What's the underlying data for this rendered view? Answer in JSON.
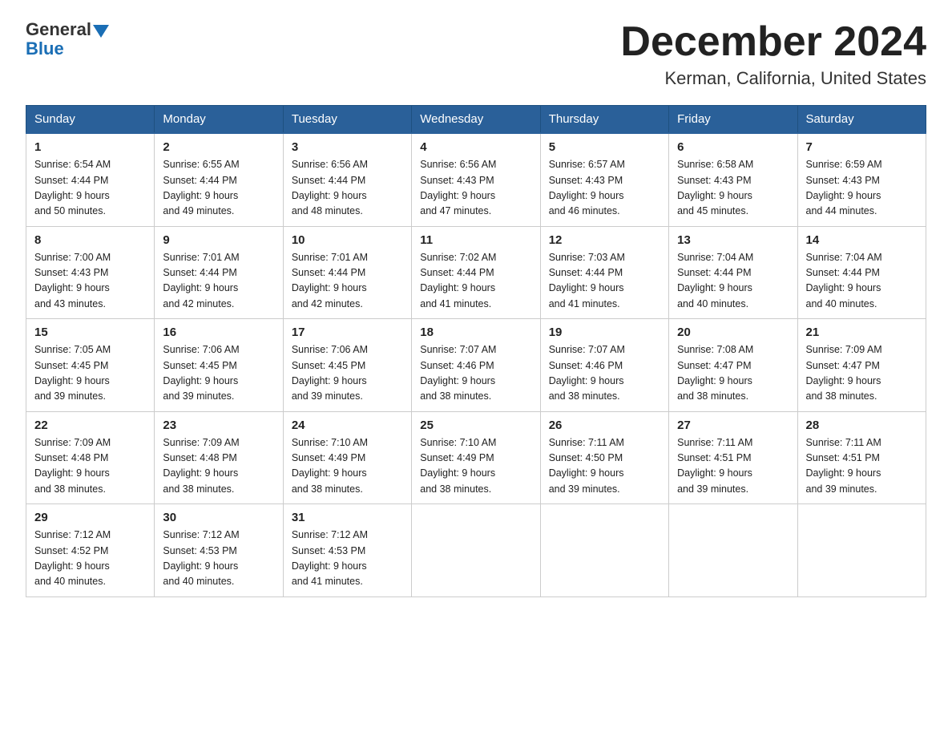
{
  "header": {
    "logo_general": "General",
    "logo_blue": "Blue",
    "month_title": "December 2024",
    "location": "Kerman, California, United States"
  },
  "days_of_week": [
    "Sunday",
    "Monday",
    "Tuesday",
    "Wednesday",
    "Thursday",
    "Friday",
    "Saturday"
  ],
  "weeks": [
    [
      {
        "day": "1",
        "sunrise": "6:54 AM",
        "sunset": "4:44 PM",
        "daylight": "9 hours and 50 minutes."
      },
      {
        "day": "2",
        "sunrise": "6:55 AM",
        "sunset": "4:44 PM",
        "daylight": "9 hours and 49 minutes."
      },
      {
        "day": "3",
        "sunrise": "6:56 AM",
        "sunset": "4:44 PM",
        "daylight": "9 hours and 48 minutes."
      },
      {
        "day": "4",
        "sunrise": "6:56 AM",
        "sunset": "4:43 PM",
        "daylight": "9 hours and 47 minutes."
      },
      {
        "day": "5",
        "sunrise": "6:57 AM",
        "sunset": "4:43 PM",
        "daylight": "9 hours and 46 minutes."
      },
      {
        "day": "6",
        "sunrise": "6:58 AM",
        "sunset": "4:43 PM",
        "daylight": "9 hours and 45 minutes."
      },
      {
        "day": "7",
        "sunrise": "6:59 AM",
        "sunset": "4:43 PM",
        "daylight": "9 hours and 44 minutes."
      }
    ],
    [
      {
        "day": "8",
        "sunrise": "7:00 AM",
        "sunset": "4:43 PM",
        "daylight": "9 hours and 43 minutes."
      },
      {
        "day": "9",
        "sunrise": "7:01 AM",
        "sunset": "4:44 PM",
        "daylight": "9 hours and 42 minutes."
      },
      {
        "day": "10",
        "sunrise": "7:01 AM",
        "sunset": "4:44 PM",
        "daylight": "9 hours and 42 minutes."
      },
      {
        "day": "11",
        "sunrise": "7:02 AM",
        "sunset": "4:44 PM",
        "daylight": "9 hours and 41 minutes."
      },
      {
        "day": "12",
        "sunrise": "7:03 AM",
        "sunset": "4:44 PM",
        "daylight": "9 hours and 41 minutes."
      },
      {
        "day": "13",
        "sunrise": "7:04 AM",
        "sunset": "4:44 PM",
        "daylight": "9 hours and 40 minutes."
      },
      {
        "day": "14",
        "sunrise": "7:04 AM",
        "sunset": "4:44 PM",
        "daylight": "9 hours and 40 minutes."
      }
    ],
    [
      {
        "day": "15",
        "sunrise": "7:05 AM",
        "sunset": "4:45 PM",
        "daylight": "9 hours and 39 minutes."
      },
      {
        "day": "16",
        "sunrise": "7:06 AM",
        "sunset": "4:45 PM",
        "daylight": "9 hours and 39 minutes."
      },
      {
        "day": "17",
        "sunrise": "7:06 AM",
        "sunset": "4:45 PM",
        "daylight": "9 hours and 39 minutes."
      },
      {
        "day": "18",
        "sunrise": "7:07 AM",
        "sunset": "4:46 PM",
        "daylight": "9 hours and 38 minutes."
      },
      {
        "day": "19",
        "sunrise": "7:07 AM",
        "sunset": "4:46 PM",
        "daylight": "9 hours and 38 minutes."
      },
      {
        "day": "20",
        "sunrise": "7:08 AM",
        "sunset": "4:47 PM",
        "daylight": "9 hours and 38 minutes."
      },
      {
        "day": "21",
        "sunrise": "7:09 AM",
        "sunset": "4:47 PM",
        "daylight": "9 hours and 38 minutes."
      }
    ],
    [
      {
        "day": "22",
        "sunrise": "7:09 AM",
        "sunset": "4:48 PM",
        "daylight": "9 hours and 38 minutes."
      },
      {
        "day": "23",
        "sunrise": "7:09 AM",
        "sunset": "4:48 PM",
        "daylight": "9 hours and 38 minutes."
      },
      {
        "day": "24",
        "sunrise": "7:10 AM",
        "sunset": "4:49 PM",
        "daylight": "9 hours and 38 minutes."
      },
      {
        "day": "25",
        "sunrise": "7:10 AM",
        "sunset": "4:49 PM",
        "daylight": "9 hours and 38 minutes."
      },
      {
        "day": "26",
        "sunrise": "7:11 AM",
        "sunset": "4:50 PM",
        "daylight": "9 hours and 39 minutes."
      },
      {
        "day": "27",
        "sunrise": "7:11 AM",
        "sunset": "4:51 PM",
        "daylight": "9 hours and 39 minutes."
      },
      {
        "day": "28",
        "sunrise": "7:11 AM",
        "sunset": "4:51 PM",
        "daylight": "9 hours and 39 minutes."
      }
    ],
    [
      {
        "day": "29",
        "sunrise": "7:12 AM",
        "sunset": "4:52 PM",
        "daylight": "9 hours and 40 minutes."
      },
      {
        "day": "30",
        "sunrise": "7:12 AM",
        "sunset": "4:53 PM",
        "daylight": "9 hours and 40 minutes."
      },
      {
        "day": "31",
        "sunrise": "7:12 AM",
        "sunset": "4:53 PM",
        "daylight": "9 hours and 41 minutes."
      },
      null,
      null,
      null,
      null
    ]
  ]
}
